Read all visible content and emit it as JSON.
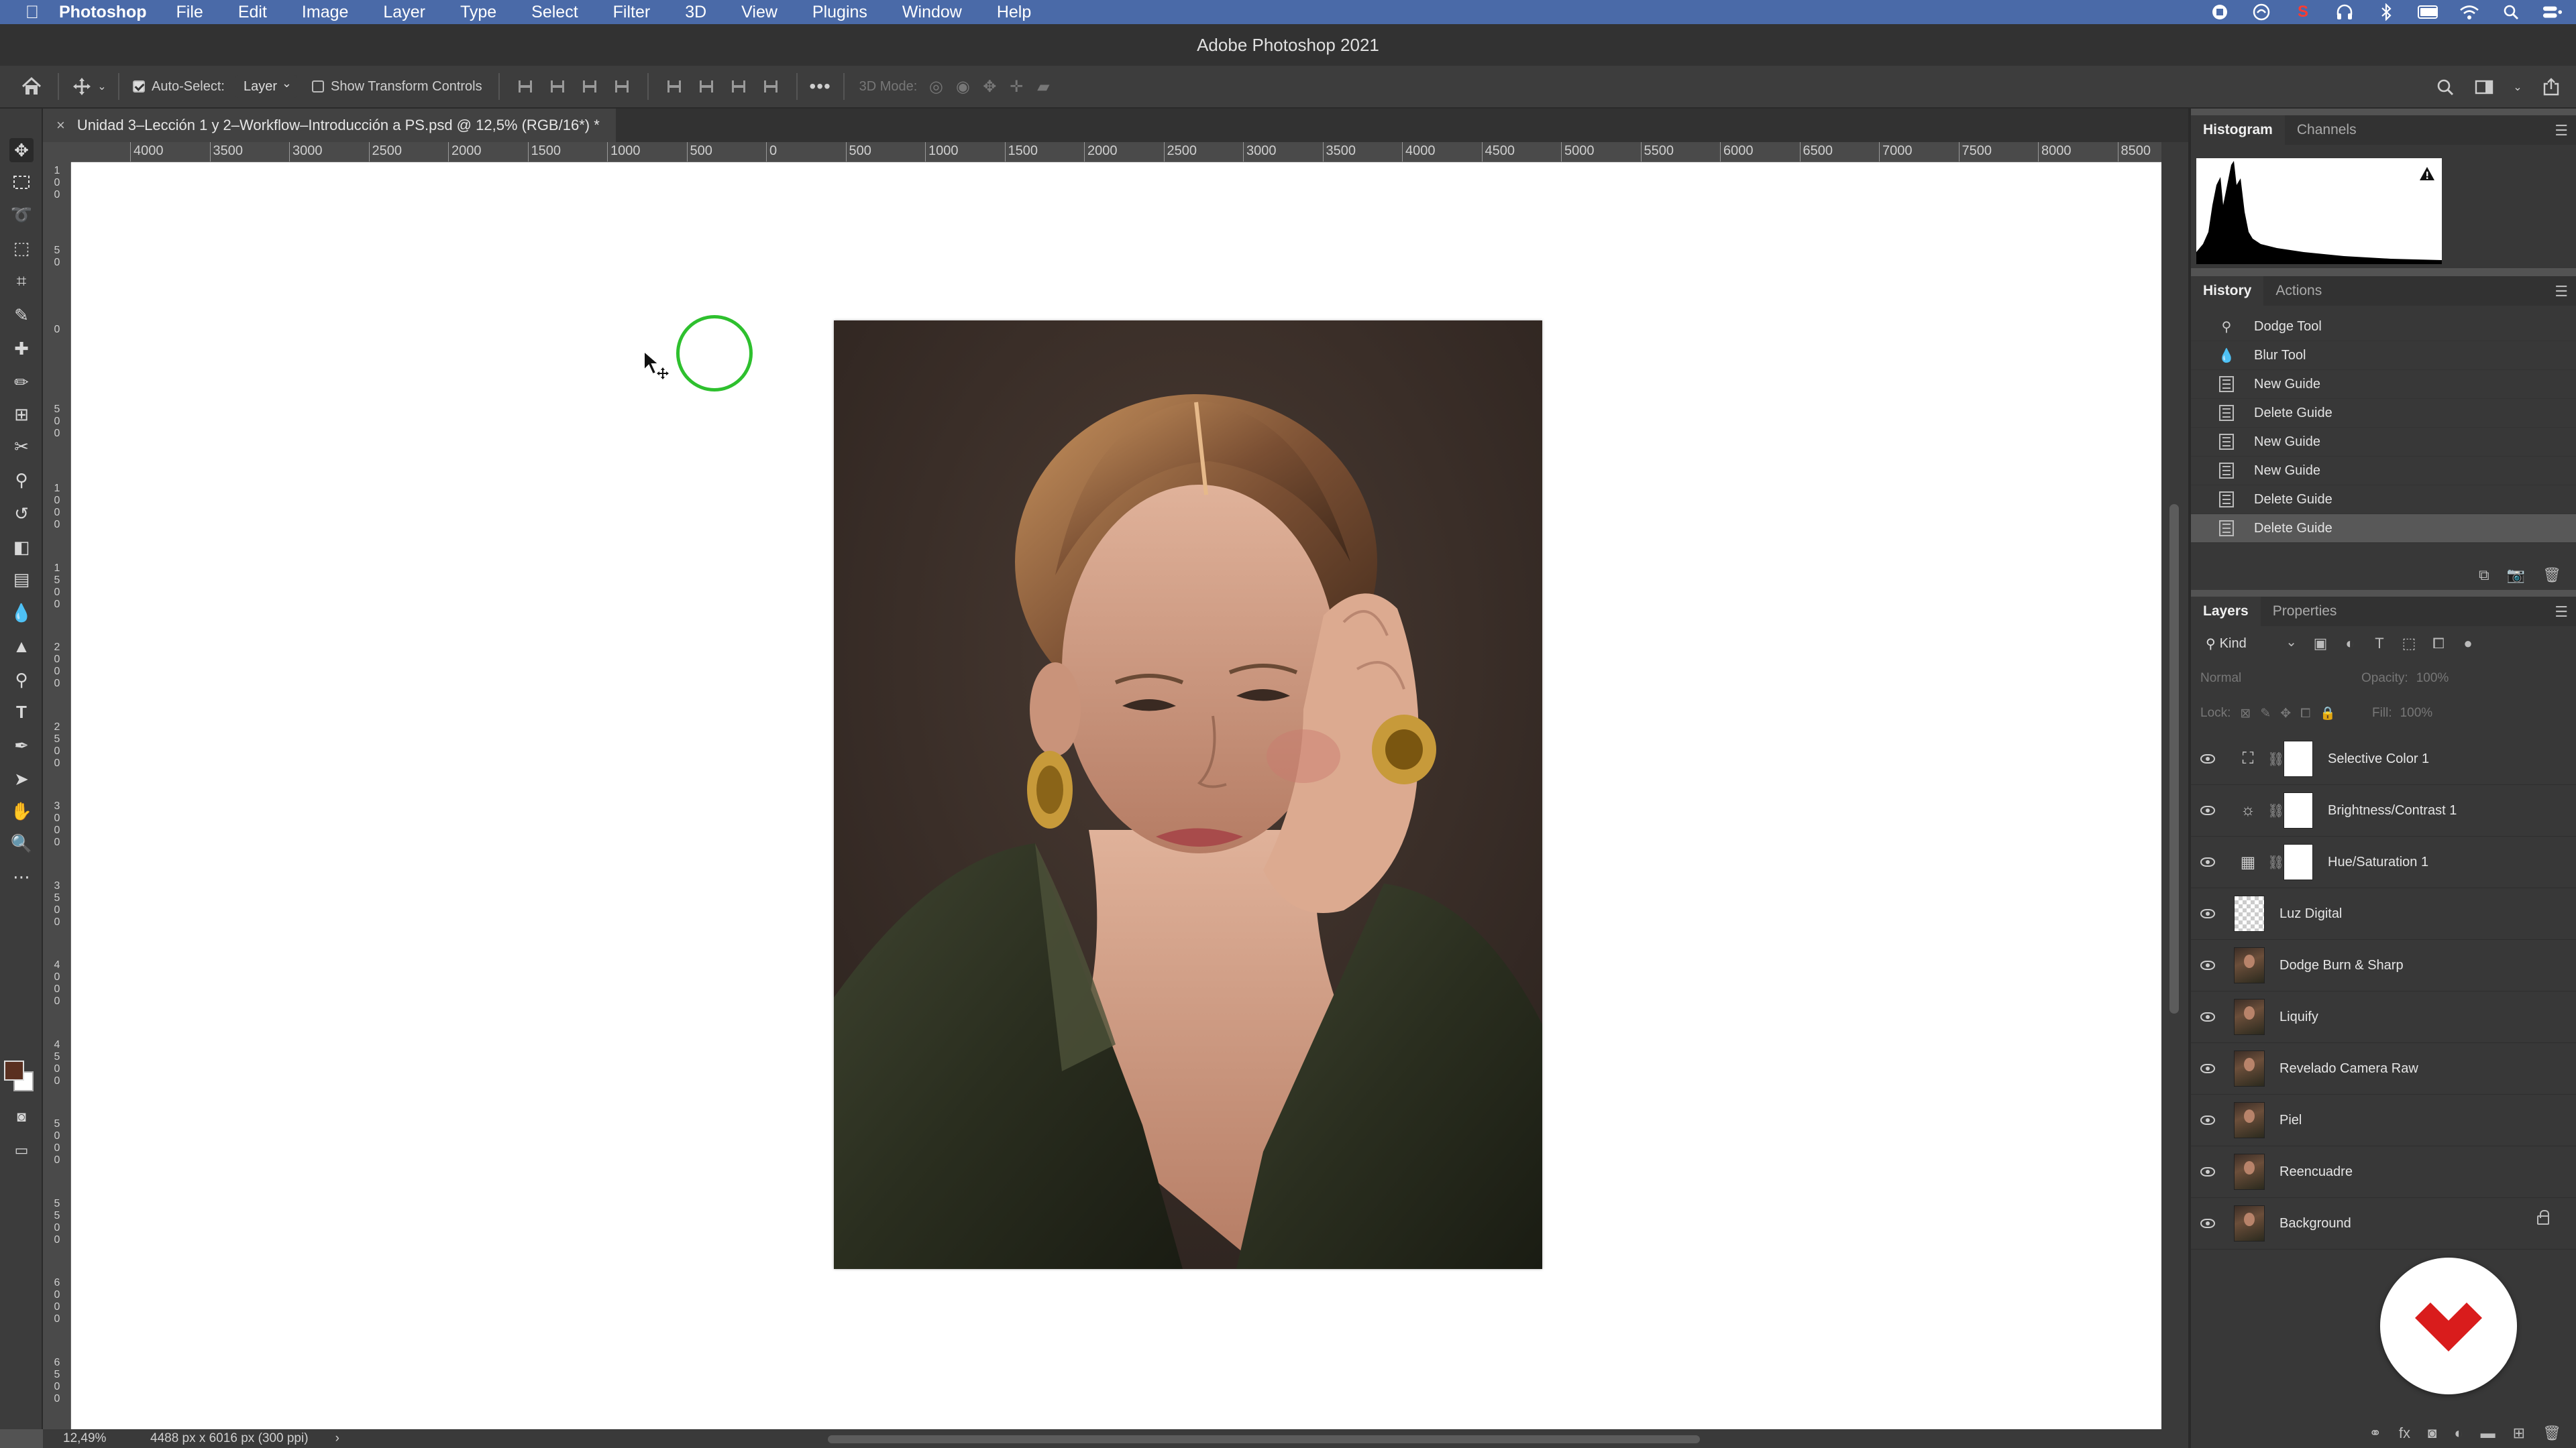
{
  "menubar": {
    "app_name": "Photoshop",
    "items": [
      "File",
      "Edit",
      "Image",
      "Layer",
      "Type",
      "Select",
      "Filter",
      "3D",
      "View",
      "Plugins",
      "Window",
      "Help"
    ],
    "status_s_letter": "S"
  },
  "window": {
    "title": "Adobe Photoshop 2021"
  },
  "options": {
    "auto_select_label": "Auto-Select:",
    "auto_select_value": "Layer",
    "show_transform_label": "Show Transform Controls",
    "mode_3d_label": "3D Mode:"
  },
  "document": {
    "tab_title": "Unidad 3–Lección 1 y 2–Workflow–Introducción a PS.psd @ 12,5% (RGB/16*) *"
  },
  "ruler": {
    "top_labels": [
      "4000",
      "3500",
      "3000",
      "2500",
      "2000",
      "1500",
      "1000",
      "500",
      "0",
      "500",
      "1000",
      "1500",
      "2000",
      "2500",
      "3000",
      "3500",
      "4000",
      "4500",
      "5000",
      "5500",
      "6000",
      "6500",
      "7000",
      "7500",
      "8000",
      "8500"
    ],
    "left_labels": [
      "1\n0\n0",
      "5\n0",
      "0",
      "5\n0\n0",
      "1\n0\n0\n0",
      "1\n5\n0\n0",
      "2\n0\n0\n0",
      "2\n5\n0\n0",
      "3\n0\n0\n0",
      "3\n5\n0\n0",
      "4\n0\n0\n0",
      "4\n5\n0\n0",
      "5\n0\n0\n0",
      "5\n5\n0\n0",
      "6\n0\n0\n0",
      "6\n5\n0\n0"
    ]
  },
  "status": {
    "zoom": "12,49%",
    "doc_info": "4488 px x 6016 px (300 ppi)",
    "arrow": "›"
  },
  "panels": {
    "histogram": {
      "tabs": [
        "Histogram",
        "Channels"
      ]
    },
    "history": {
      "tabs": [
        "History",
        "Actions"
      ],
      "items": [
        {
          "label": "Dodge Tool",
          "icon": "dodge-icon"
        },
        {
          "label": "Blur Tool",
          "icon": "blur-icon"
        },
        {
          "label": "New Guide",
          "icon": "doc-icon"
        },
        {
          "label": "Delete Guide",
          "icon": "doc-icon"
        },
        {
          "label": "New Guide",
          "icon": "doc-icon"
        },
        {
          "label": "New Guide",
          "icon": "doc-icon"
        },
        {
          "label": "Delete Guide",
          "icon": "doc-icon"
        },
        {
          "label": "Delete Guide",
          "icon": "doc-icon",
          "selected": true
        }
      ]
    },
    "layers": {
      "tabs": [
        "Layers",
        "Properties"
      ],
      "filter_label": "Kind",
      "blend_mode": "Normal",
      "opacity_label": "Opacity:",
      "opacity_value": "100%",
      "lock_label": "Lock:",
      "fill_label": "Fill:",
      "fill_value": "100%",
      "items": [
        {
          "name": "Selective Color 1",
          "type": "adjustment",
          "icon": "selective-color-icon"
        },
        {
          "name": "Brightness/Contrast 1",
          "type": "adjustment",
          "icon": "brightness-icon"
        },
        {
          "name": "Hue/Saturation 1",
          "type": "adjustment",
          "icon": "hue-saturation-icon"
        },
        {
          "name": "Luz Digital",
          "type": "transparent"
        },
        {
          "name": "Dodge Burn & Sharp",
          "type": "image"
        },
        {
          "name": "Liquify",
          "type": "image"
        },
        {
          "name": "Revelado Camera Raw",
          "type": "image"
        },
        {
          "name": "Piel",
          "type": "image"
        },
        {
          "name": "Reencuadre",
          "type": "image"
        },
        {
          "name": "Background",
          "type": "image",
          "locked": true
        }
      ]
    }
  },
  "colors": {
    "menubar": "#4a6aa8",
    "cursor_ring": "#2ec02e",
    "logo_red": "#d91c1c"
  }
}
